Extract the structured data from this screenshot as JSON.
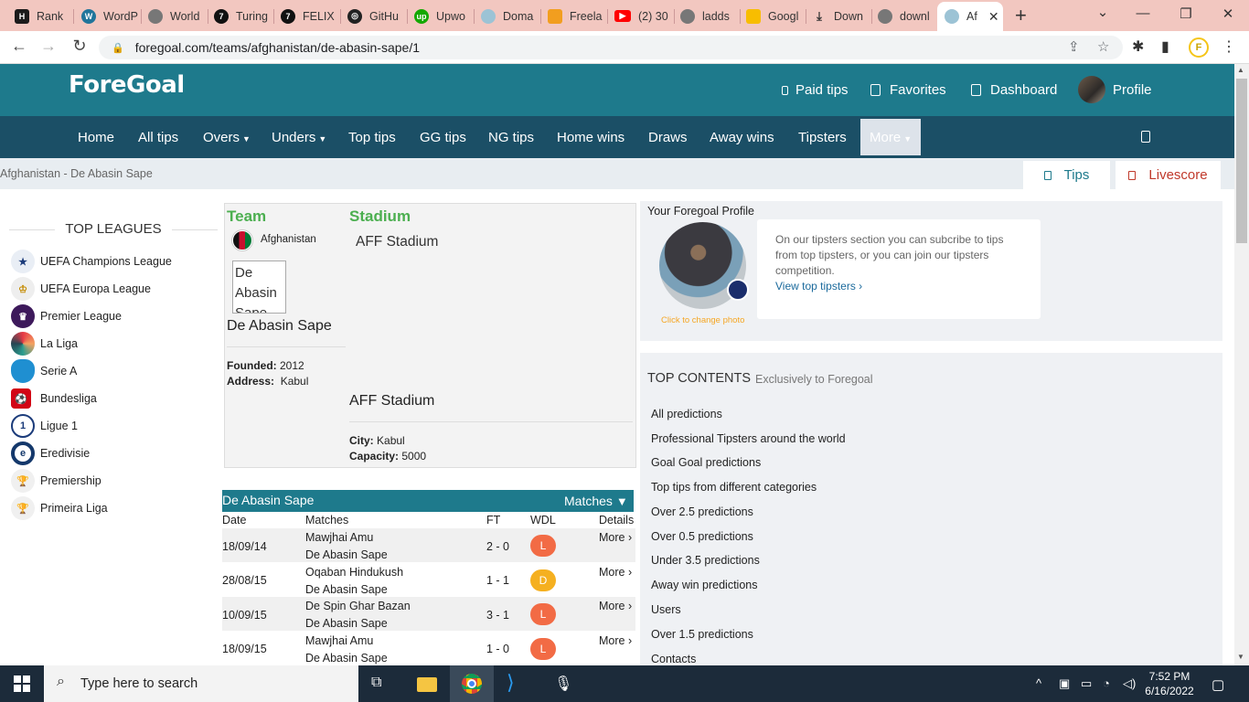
{
  "browser": {
    "tabs": [
      {
        "label": "Rank",
        "icon": "hostinger-icon",
        "color": "#1b1b1b"
      },
      {
        "label": "WordP",
        "icon": "wordpress-icon",
        "color": "#21759b"
      },
      {
        "label": "World",
        "icon": "globe-icon",
        "color": "#666"
      },
      {
        "label": "Turing",
        "icon": "turing-icon",
        "color": "#111"
      },
      {
        "label": "FELIX",
        "icon": "turing-icon",
        "color": "#111"
      },
      {
        "label": "GitHu",
        "icon": "github-icon",
        "color": "#222"
      },
      {
        "label": "Upwo",
        "icon": "upwork-icon",
        "color": "#14a800"
      },
      {
        "label": "Doma",
        "icon": "domain-icon",
        "color": "#7fb0c7"
      },
      {
        "label": "Freela",
        "icon": "freelancer-icon",
        "color": "#f29e1f"
      },
      {
        "label": "(2) 30",
        "icon": "youtube-icon",
        "color": "#ff0000"
      },
      {
        "label": "ladds",
        "icon": "globe-icon",
        "color": "#666"
      },
      {
        "label": "Googl",
        "icon": "google-keep-icon",
        "color": "#f8bd00"
      },
      {
        "label": "Down",
        "icon": "download-icon",
        "color": "#333"
      },
      {
        "label": "downl",
        "icon": "globe-icon",
        "color": "#666"
      },
      {
        "label": "Af",
        "icon": "foregoal-icon",
        "color": "#7fb0c7"
      }
    ],
    "url": "foregoal.com/teams/afghanistan/de-abasin-sape/1"
  },
  "header": {
    "logo": "ForeGoal",
    "links": [
      "Paid tips",
      "Favorites",
      "Dashboard"
    ],
    "profile_label": "Profile"
  },
  "nav": {
    "items": [
      "Home",
      "All tips",
      "Overs",
      "Unders",
      "Top tips",
      "GG tips",
      "NG tips",
      "Home wins",
      "Draws",
      "Away wins",
      "Tipsters",
      "More"
    ]
  },
  "breadcrumb": "Afghanistan - De Abasin Sape",
  "side_tabs": {
    "tips": "Tips",
    "livescore": "Livescore"
  },
  "sidebar": {
    "title": "TOP LEAGUES",
    "leagues": [
      "UEFA Champions League",
      "UEFA Europa League",
      "Premier League",
      "La Liga",
      "Serie A",
      "Bundesliga",
      "Ligue 1",
      "Eredivisie",
      "Premiership",
      "Primeira Liga"
    ]
  },
  "team": {
    "team_heading": "Team",
    "stadium_heading": "Stadium",
    "country": "Afghanistan",
    "logo_alt": "De Abasin Sape",
    "name": "De Abasin Sape",
    "founded_label": "Founded:",
    "founded": "2012",
    "address_label": "Address:",
    "address": "Kabul",
    "stadium_img_alt": "AFF Stadium",
    "stadium_name": "AFF Stadium",
    "city_label": "City:",
    "city": "Kabul",
    "capacity_label": "Capacity:",
    "capacity": "5000"
  },
  "matches": {
    "team": "De Abasin Sape",
    "toggle": "Matches",
    "columns": [
      "Date",
      "Matches",
      "FT",
      "WDL",
      "Details"
    ],
    "rows": [
      {
        "date": "18/09/14",
        "home": "Mawjhai Amu",
        "away": "De Abasin Sape",
        "ft": "2 - 0",
        "wdl": "L",
        "details": "More ›"
      },
      {
        "date": "28/08/15",
        "home": "Oqaban Hindukush",
        "away": "De Abasin Sape",
        "ft": "1 - 1",
        "wdl": "D",
        "details": "More ›"
      },
      {
        "date": "10/09/15",
        "home": "De Spin Ghar Bazan",
        "away": "De Abasin Sape",
        "ft": "3 - 1",
        "wdl": "L",
        "details": "More ›"
      },
      {
        "date": "18/09/15",
        "home": "Mawjhai Amu",
        "away": "De Abasin Sape",
        "ft": "1 - 0",
        "wdl": "L",
        "details": "More ›"
      }
    ]
  },
  "profile": {
    "title": "Your Foregoal Profile",
    "change_photo": "Click to change photo",
    "bubble_text": "On our tipsters section you can subcribe to tips from top tipsters, or you can join our tipsters competition.",
    "bubble_link": "View top tipsters ›"
  },
  "top_contents": {
    "title": "TOP CONTENTS",
    "subtitle": "Exclusively to Foregoal",
    "links": [
      "All predictions",
      "Professional Tipsters around the world",
      "Goal Goal predictions",
      "Top tips from different categories",
      "Over 2.5 predictions",
      "Over 0.5 predictions",
      "Under 3.5 predictions",
      "Away win predictions",
      "Users",
      "Over 1.5 predictions",
      "Contacts"
    ]
  },
  "taskbar": {
    "search_placeholder": "Type here to search",
    "time": "7:52 PM",
    "date": "6/16/2022"
  },
  "colors": {
    "header": "#1e7a8c",
    "nav": "#1b4f66",
    "accent_green": "#4caf50",
    "loss": "#f26b45",
    "draw": "#f5b020",
    "livescore": "#c0392b",
    "tips": "#1e7a8c"
  }
}
